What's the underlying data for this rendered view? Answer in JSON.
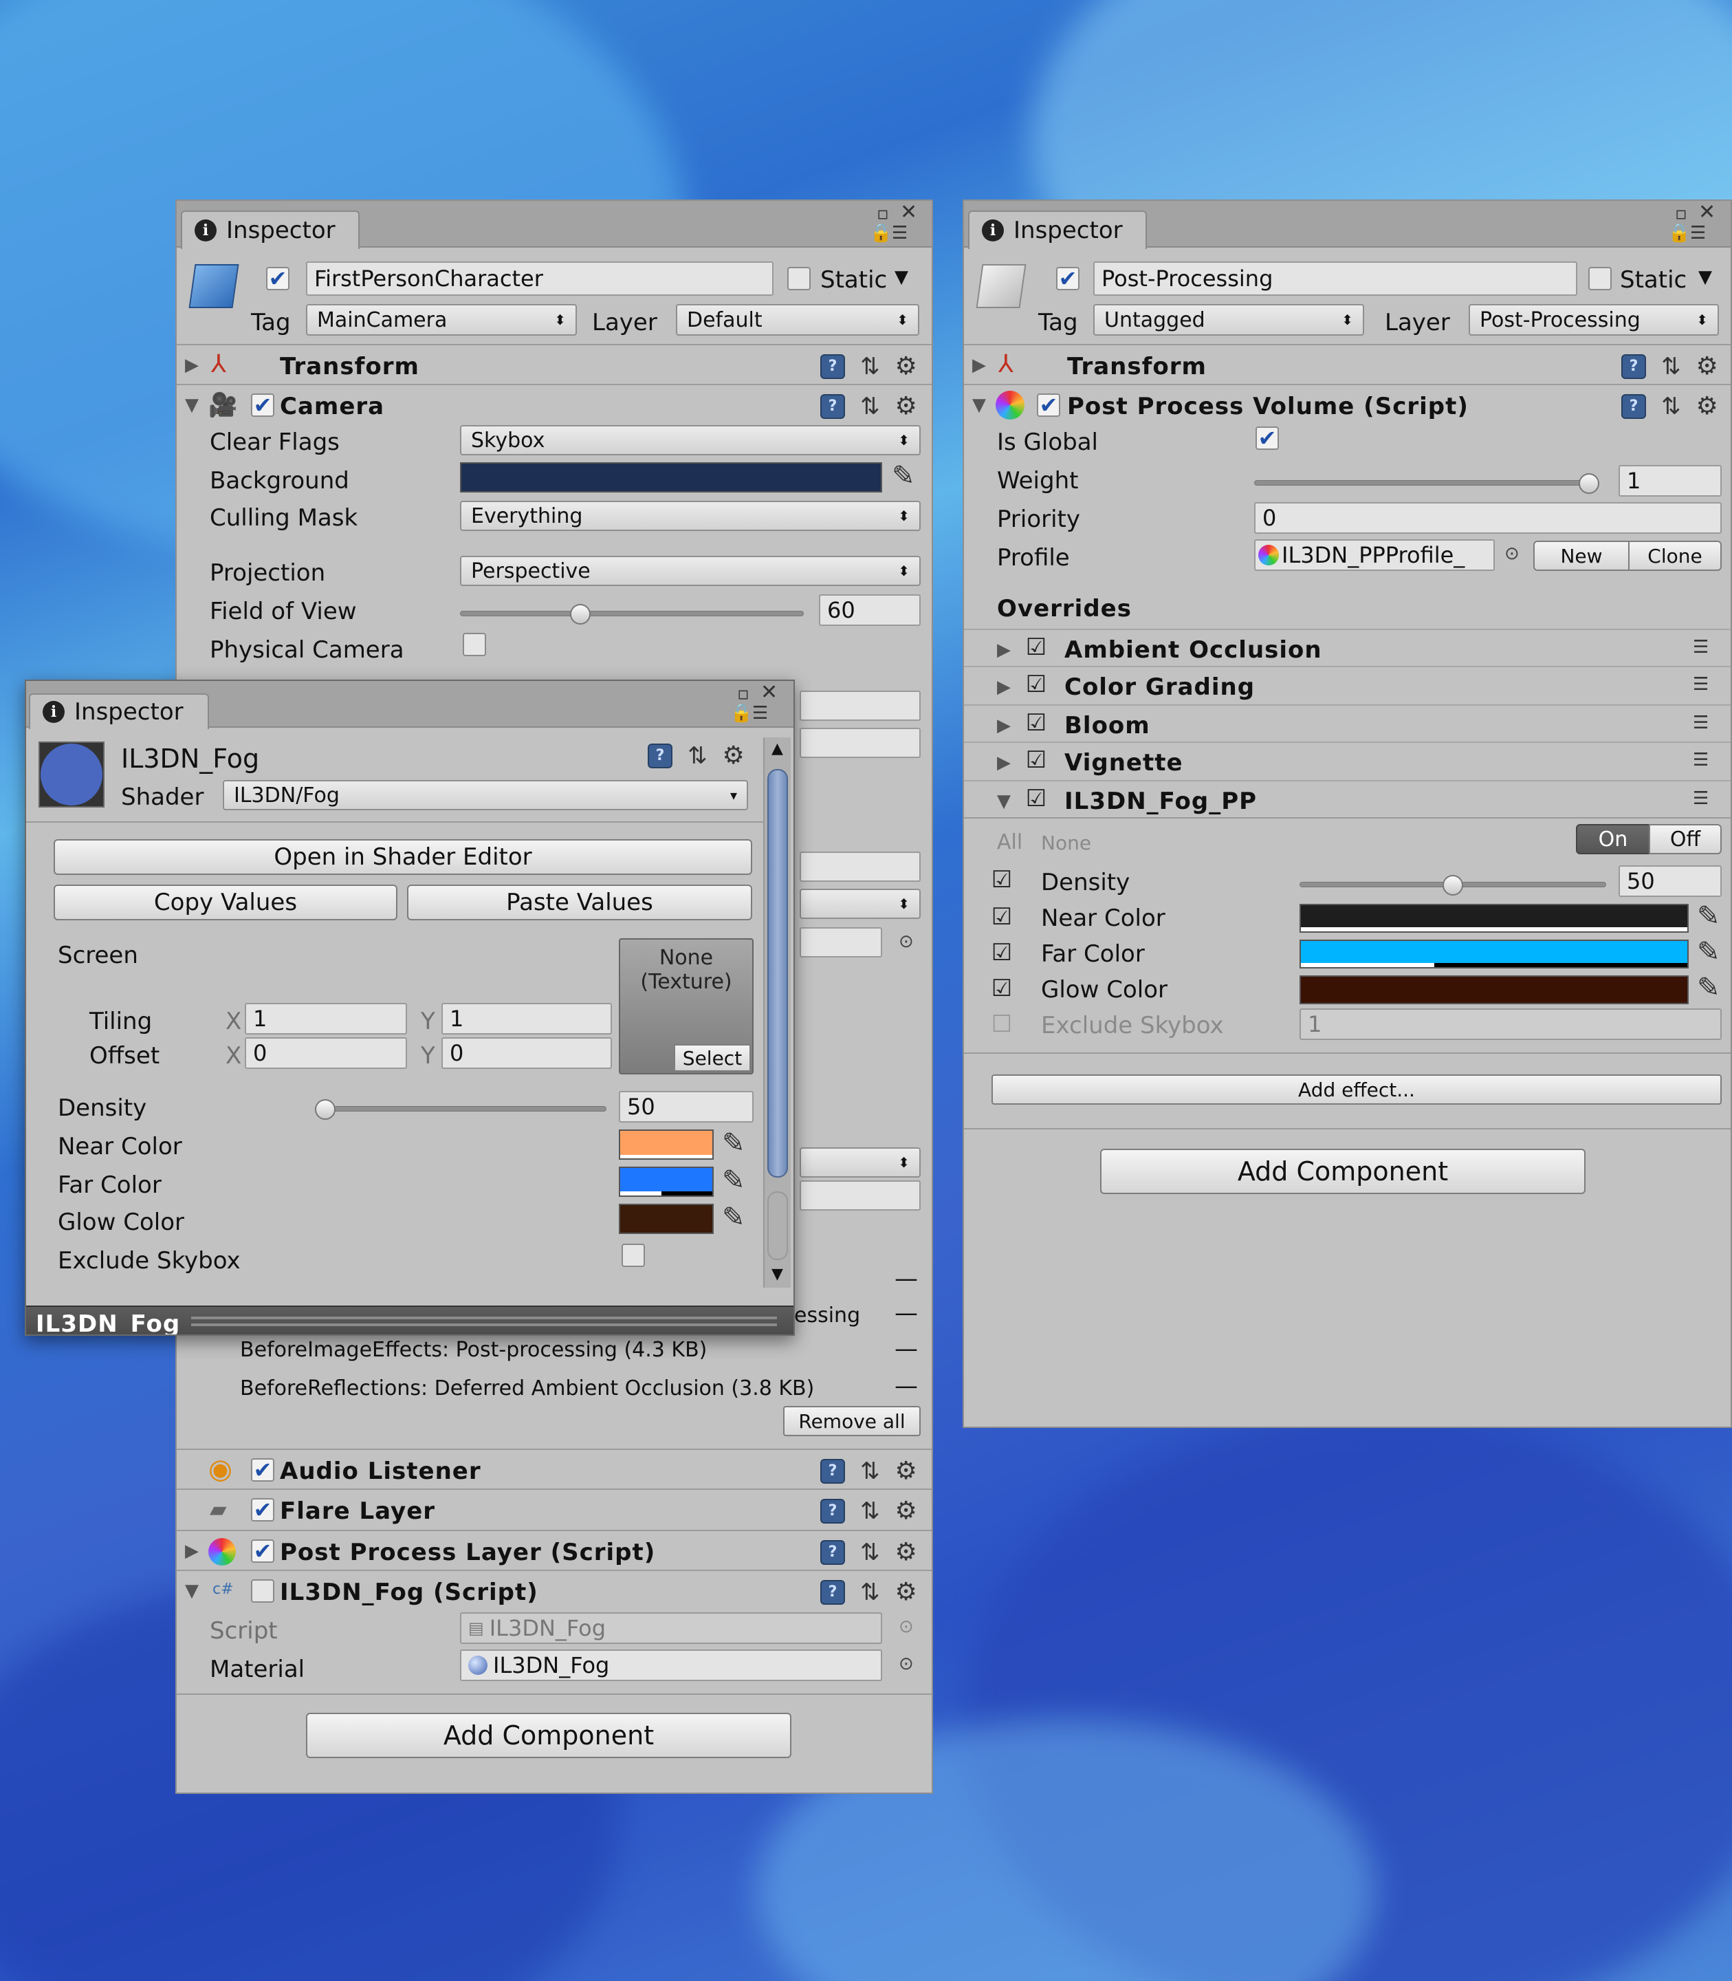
{
  "colors": {
    "panel": "#c2c2c2",
    "bg": "#2f6fd0",
    "check_blue": "#1f4fa8"
  },
  "inspector_left": {
    "tab": "Inspector",
    "object_name": "FirstPersonCharacter",
    "static_label": "Static",
    "tag_label": "Tag",
    "tag_value": "MainCamera",
    "layer_label": "Layer",
    "layer_value": "Default",
    "transform": "Transform",
    "camera": {
      "title": "Camera",
      "clear_flags_label": "Clear Flags",
      "clear_flags": "Skybox",
      "background_label": "Background",
      "background_color": "#1d2f52",
      "culling_mask_label": "Culling Mask",
      "culling_mask": "Everything",
      "projection_label": "Projection",
      "projection": "Perspective",
      "fov_label": "Field of View",
      "fov": "60",
      "fov_fraction": 0.34,
      "physical_camera_label": "Physical Camera"
    },
    "partial_text": "essing",
    "command_buffers": [
      "BeforeImageEffects: Post-processing (4.3 KB)",
      "BeforeReflections: Deferred Ambient Occlusion (3.8 KB)"
    ],
    "remove_all": "Remove all",
    "components": [
      "Audio Listener",
      "Flare Layer",
      "Post Process Layer (Script)",
      "IL3DN_Fog (Script)"
    ],
    "script_label": "Script",
    "script_value": "IL3DN_Fog",
    "material_label": "Material",
    "material_value": "IL3DN_Fog",
    "add_component": "Add Component"
  },
  "inspector_float": {
    "tab": "Inspector",
    "material_name": "IL3DN_Fog",
    "shader_label": "Shader",
    "shader_value": "IL3DN/Fog",
    "open_shader_editor": "Open in Shader Editor",
    "copy_values": "Copy Values",
    "paste_values": "Paste Values",
    "screen_label": "Screen",
    "texture_none": "None\n(Texture)",
    "texture_select": "Select",
    "tiling_label": "Tiling",
    "offset_label": "Offset",
    "x_label": "X",
    "y_label": "Y",
    "tiling_x": "1",
    "tiling_y": "1",
    "offset_x": "0",
    "offset_y": "0",
    "density_label": "Density",
    "density": "50",
    "density_fraction": 0.0,
    "near_color_label": "Near Color",
    "near_color": "#ffa060",
    "far_color_label": "Far Color",
    "far_color": "#1e78ff",
    "glow_color_label": "Glow Color",
    "glow_color": "#3a1a08",
    "exclude_skybox_label": "Exclude Skybox",
    "footer": "IL3DN_Fog"
  },
  "inspector_right": {
    "tab": "Inspector",
    "object_name": "Post-Processing",
    "static_label": "Static",
    "tag_label": "Tag",
    "tag_value": "Untagged",
    "layer_label": "Layer",
    "layer_value": "Post-Processing",
    "transform": "Transform",
    "ppv_title": "Post Process Volume (Script)",
    "is_global_label": "Is Global",
    "weight_label": "Weight",
    "weight": "1",
    "weight_fraction": 1.0,
    "priority_label": "Priority",
    "priority": "0",
    "profile_label": "Profile",
    "profile_value": "IL3DN_PPProfile_",
    "new_label": "New",
    "clone_label": "Clone",
    "overrides_label": "Overrides",
    "effects": [
      "Ambient Occlusion",
      "Color Grading",
      "Bloom",
      "Vignette",
      "IL3DN_Fog_PP"
    ],
    "all_label": "All",
    "none_label": "None",
    "on_label": "On",
    "off_label": "Off",
    "density_label": "Density",
    "density": "50",
    "density_fraction": 0.5,
    "near_color_label": "Near Color",
    "near_color": "#1e1e1e",
    "far_color_label": "Far Color",
    "far_color": "#00b4ff",
    "glow_color_label": "Glow Color",
    "glow_color": "#3a1204",
    "exclude_skybox_label": "Exclude Skybox",
    "exclude_skybox": "1",
    "add_effect": "Add effect...",
    "add_component": "Add Component"
  }
}
